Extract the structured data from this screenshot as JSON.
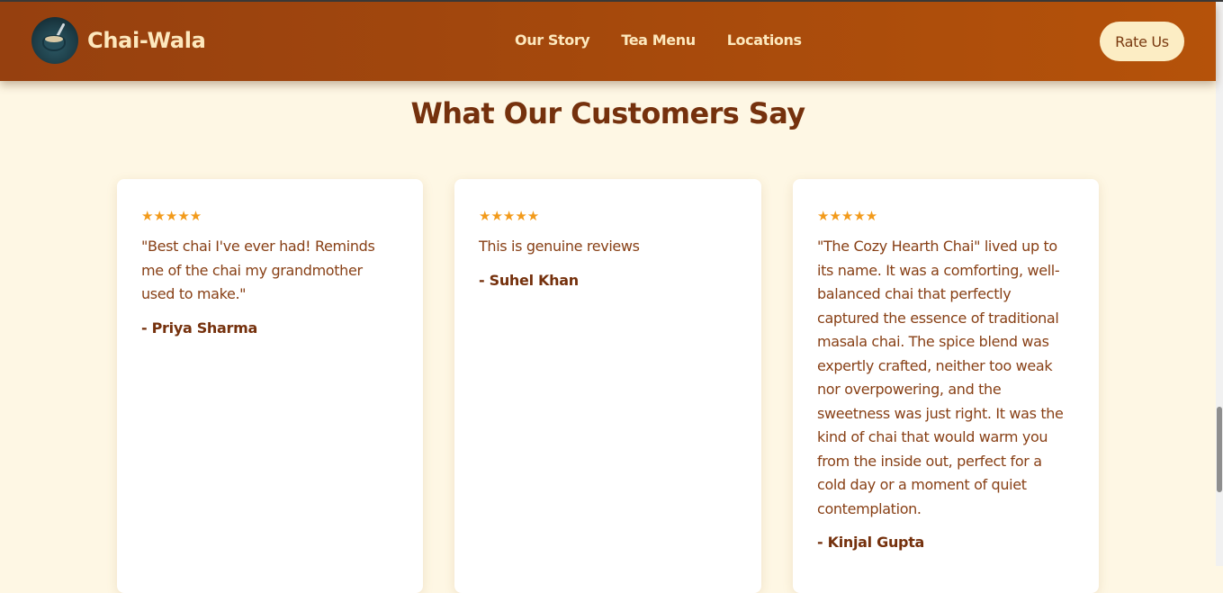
{
  "brand": {
    "name": "Chai-Wala",
    "logo_icon": "tea-cup-icon"
  },
  "nav": {
    "links": [
      "Our Story",
      "Tea Menu",
      "Locations"
    ],
    "cta_label": "Rate Us"
  },
  "section": {
    "title": "What Our Customers Say"
  },
  "reviews": [
    {
      "stars": "★★★★★",
      "text": "\"Best chai I've ever had! Reminds me of the chai my grandmother used to make.\"",
      "author": "- Priya Sharma"
    },
    {
      "stars": "★★★★★",
      "text": "This is genuine reviews",
      "author": "- Suhel Khan"
    },
    {
      "stars": "★★★★★",
      "text": "\"The Cozy Hearth Chai\" lived up to its name. It was a comforting, well-balanced chai that perfectly captured the essence of traditional masala chai. The spice blend was expertly crafted, neither too weak nor overpowering, and the sweetness was just right. It was the kind of chai that would warm you from the inside out, perfect for a cold day or a moment of quiet contemplation.",
      "author": "- Kinjal Gupta"
    }
  ],
  "colors": {
    "nav_gradient_start": "#96400f",
    "nav_gradient_end": "#b5520a",
    "page_background": "#fef7e4",
    "heading": "#75310d",
    "star": "#f29a1a",
    "cta_background": "#fcedc4"
  }
}
